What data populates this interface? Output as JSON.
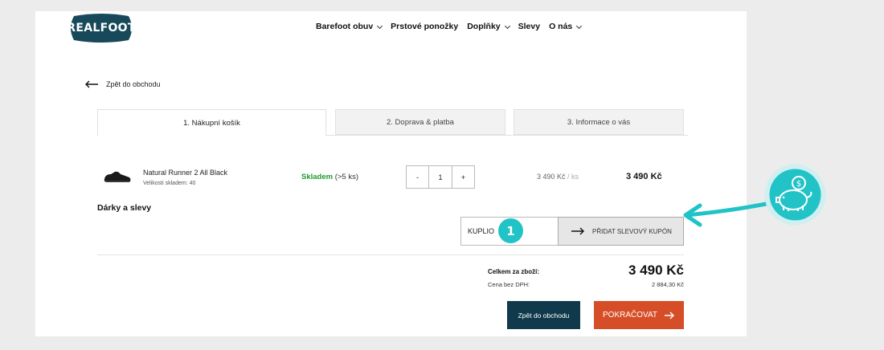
{
  "header": {
    "logo_text": "REALFOOT",
    "nav": [
      {
        "label": "Barefoot obuv",
        "dropdown": true
      },
      {
        "label": "Prstové ponožky",
        "dropdown": false
      },
      {
        "label": "Doplňky",
        "dropdown": true
      },
      {
        "label": "Slevy",
        "dropdown": false
      },
      {
        "label": "O nás",
        "dropdown": true
      }
    ]
  },
  "back_link": "Zpět do obchodu",
  "tabs": [
    {
      "label": "1. Nákupní košík",
      "active": true
    },
    {
      "label": "2. Doprava & platba",
      "active": false
    },
    {
      "label": "3. Informace o vás",
      "active": false
    }
  ],
  "cart_item": {
    "name": "Natural Runner 2 All Black",
    "size": "Velikosti skladem: 40",
    "stock_status": "Skladem",
    "stock_count": "(>5 ks)",
    "qty_minus": "-",
    "quantity": "1",
    "qty_plus": "+",
    "unit_price": "3 490 Kč",
    "unit_suffix": "/ ks",
    "total": "3 490 Kč"
  },
  "discounts": {
    "title": "Dárky a slevy",
    "coupon_value": "KUPLIO",
    "coupon_button": "PŘIDAT SLEVOVÝ KUPÓN",
    "marker": "1"
  },
  "totals": {
    "sum_label": "Celkem za zboží:",
    "sum_value": "3 490 Kč",
    "net_label": "Cena bez DPH:",
    "net_value": "2 884,30 Kč"
  },
  "buttons": {
    "back": "Zpět do obchodu",
    "continue": "POKRAČOVAT"
  },
  "colors": {
    "brand_dark": "#103a4c",
    "accent_orange": "#d64e27",
    "stock_green": "#1e9a31",
    "annotation_teal": "#21c3c7"
  },
  "icons": [
    "back-arrow-icon",
    "chevron-down-icon",
    "arrow-right-icon",
    "piggy-bank-icon"
  ]
}
